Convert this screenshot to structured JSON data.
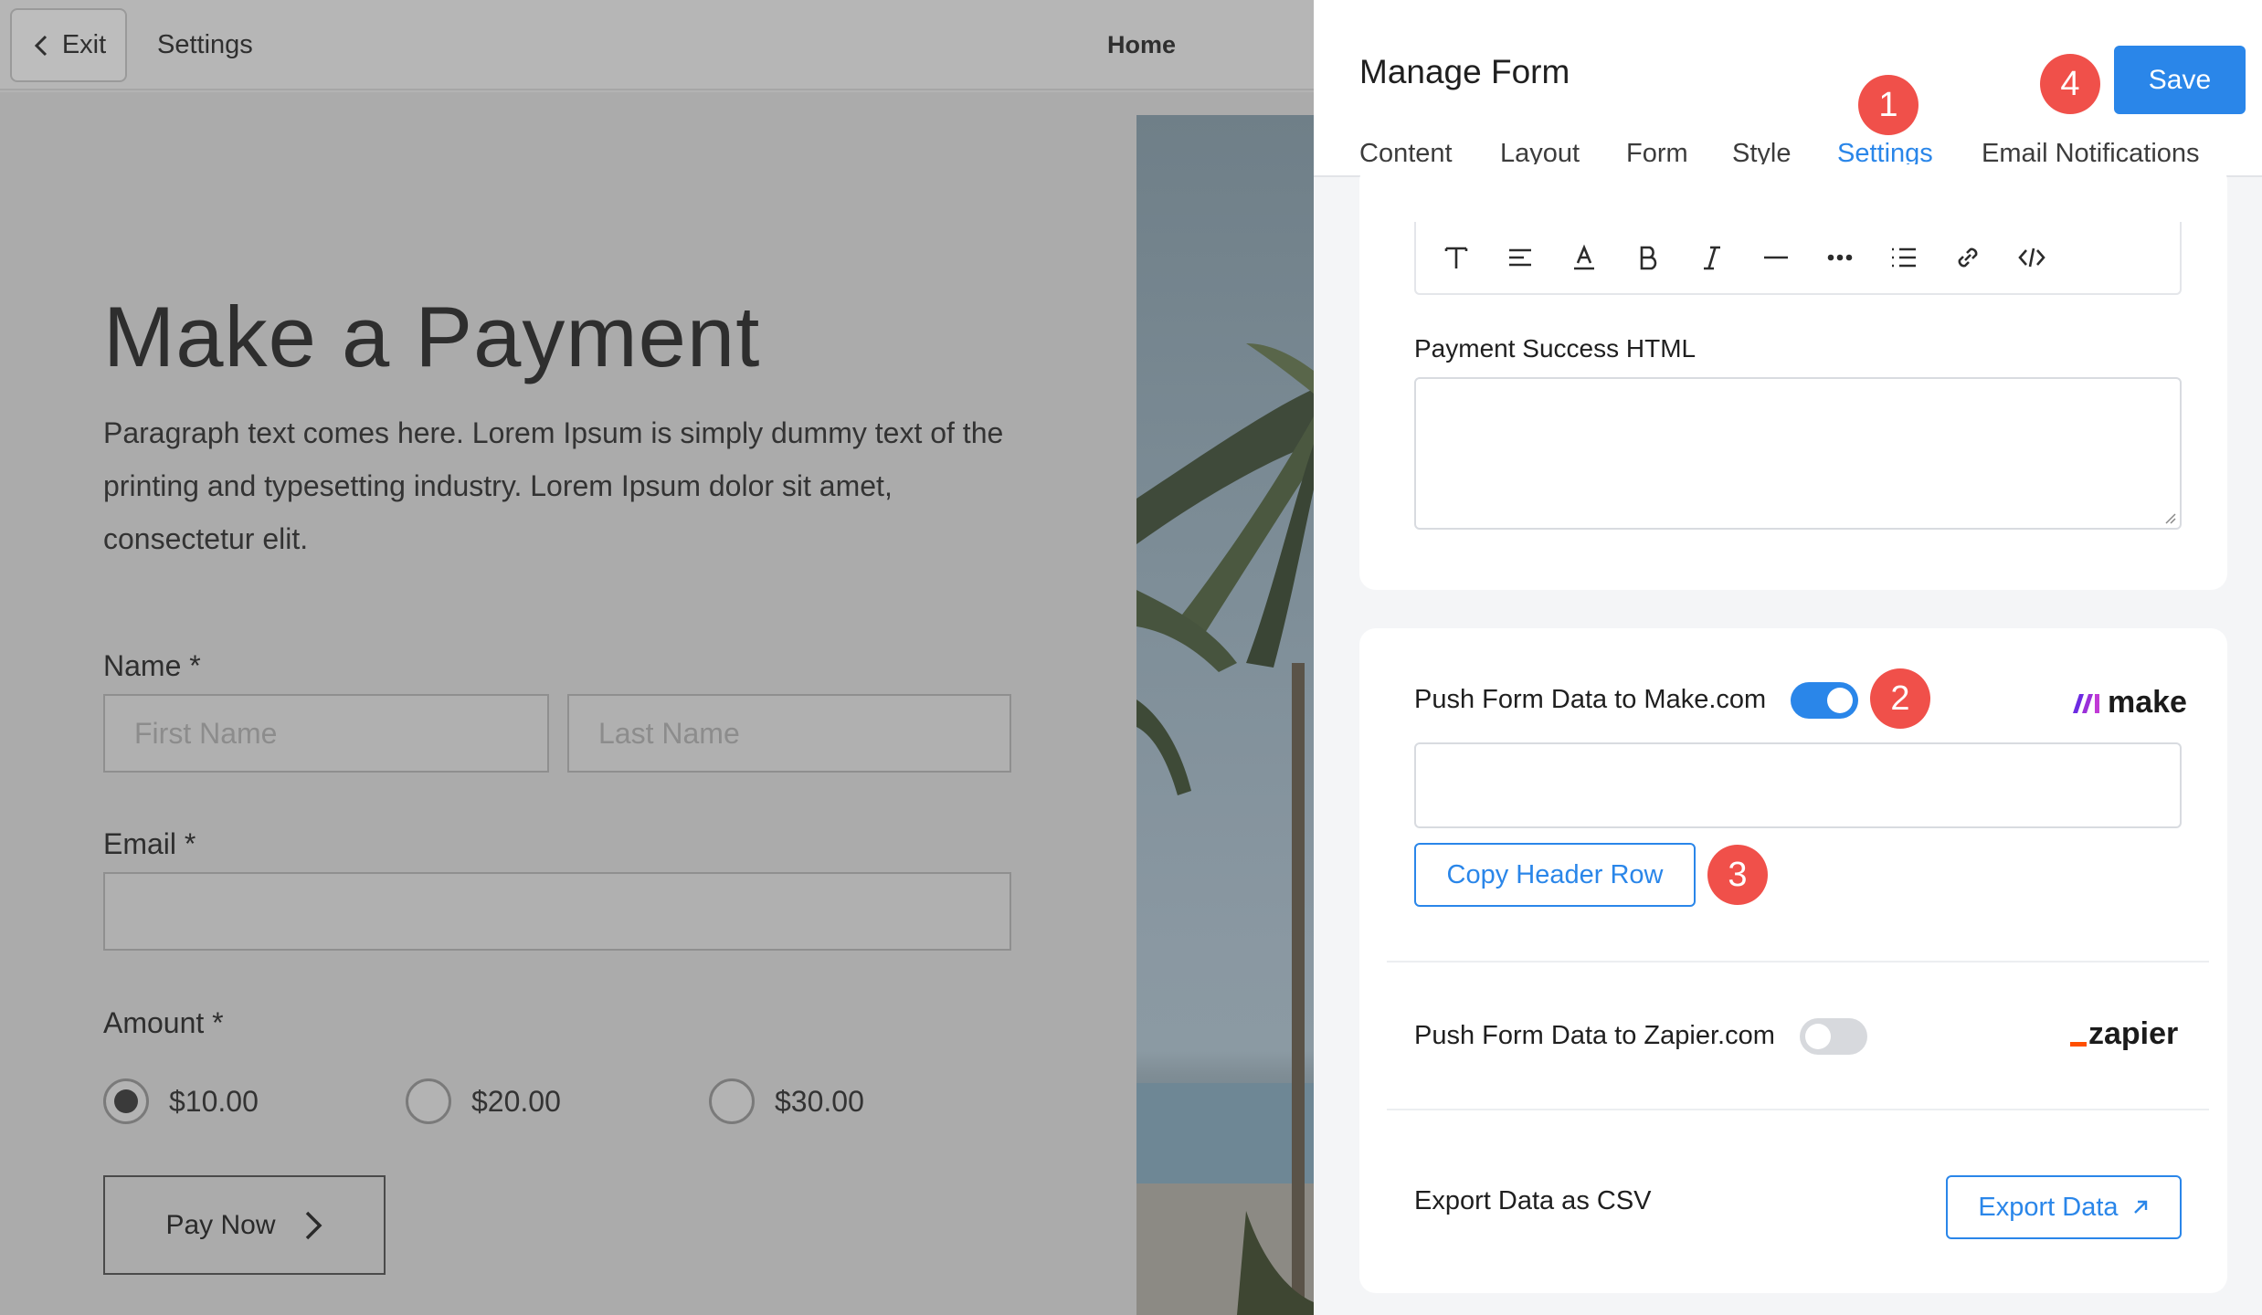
{
  "editor": {
    "exit_label": "Exit",
    "settings_label": "Settings",
    "home_label": "Home"
  },
  "page": {
    "title": "Make a Payment",
    "paragraph": "Paragraph text comes here. Lorem Ipsum is simply dummy text of the printing and typesetting industry. Lorem Ipsum dolor sit amet, consectetur elit.",
    "name_label": "Name *",
    "first_name_placeholder": "First Name",
    "last_name_placeholder": "Last Name",
    "email_label": "Email *",
    "amount_label": "Amount *",
    "amounts": [
      "$10.00",
      "$20.00",
      "$30.00"
    ],
    "selected_amount": "$10.00",
    "pay_now_label": "Pay Now"
  },
  "panel": {
    "title": "Manage Form",
    "save_label": "Save",
    "tabs": [
      "Content",
      "Layout",
      "Form",
      "Style",
      "Settings",
      "Email Notifications"
    ],
    "active_tab": "Settings",
    "toolbar_icons": [
      "text-type-icon",
      "align-icon",
      "font-color-icon",
      "bold-icon",
      "italic-icon",
      "horizontal-rule-icon",
      "more-icon",
      "list-icon",
      "link-icon",
      "code-icon"
    ],
    "payment_success_label": "Payment Success HTML",
    "make": {
      "label": "Push Form Data to Make.com",
      "enabled": true,
      "logo_text": "make",
      "copy_button": "Copy Header Row"
    },
    "zapier": {
      "label": "Push Form Data to Zapier.com",
      "enabled": false,
      "logo_text": "zapier"
    },
    "export": {
      "label": "Export Data as CSV",
      "button": "Export Data"
    },
    "badges": [
      "1",
      "2",
      "3",
      "4"
    ]
  },
  "colors": {
    "accent": "#2a86e9",
    "badge": "#f0504a",
    "overlay": "#b3b3b3",
    "make_brand": "#8b2be2",
    "zapier_brand": "#ff4f00"
  }
}
